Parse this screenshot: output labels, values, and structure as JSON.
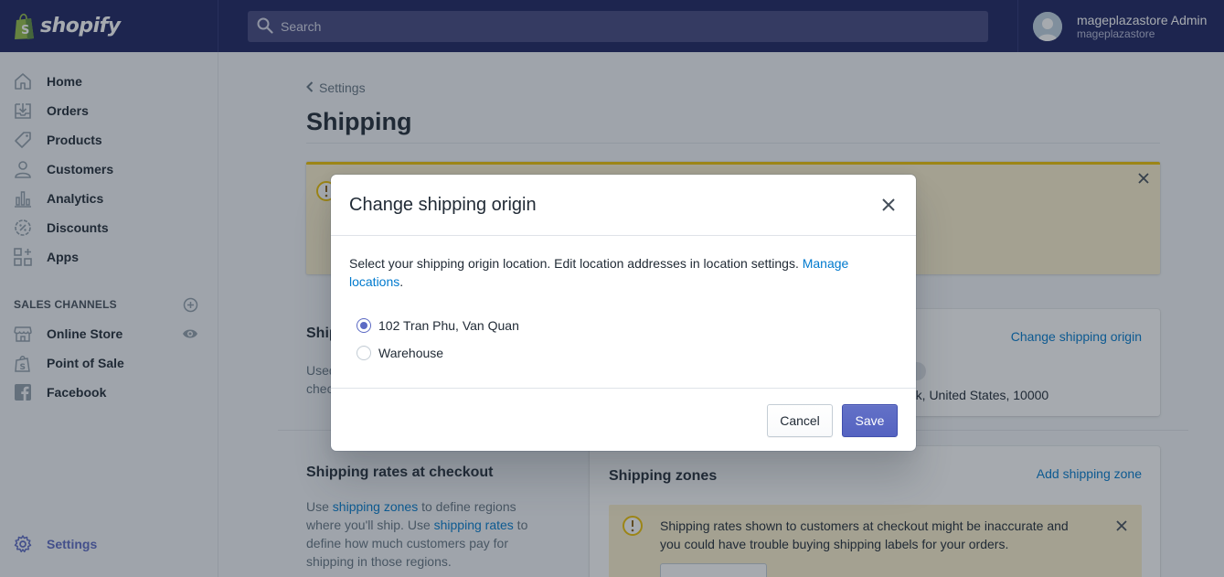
{
  "topbar": {
    "brand": "shopify",
    "search_placeholder": "Search",
    "user_name": "mageplazastore Admin",
    "user_store": "mageplazastore"
  },
  "sidebar": {
    "items": [
      {
        "label": "Home",
        "icon": "home-icon"
      },
      {
        "label": "Orders",
        "icon": "orders-icon"
      },
      {
        "label": "Products",
        "icon": "tag-icon"
      },
      {
        "label": "Customers",
        "icon": "person-icon"
      },
      {
        "label": "Analytics",
        "icon": "bar-chart-icon"
      },
      {
        "label": "Discounts",
        "icon": "discount-icon"
      },
      {
        "label": "Apps",
        "icon": "apps-icon"
      }
    ],
    "sales_channels_heading": "SALES CHANNELS",
    "channels": [
      {
        "label": "Online Store",
        "icon": "store-icon"
      },
      {
        "label": "Point of Sale",
        "icon": "pos-icon"
      },
      {
        "label": "Facebook",
        "icon": "facebook-icon"
      }
    ],
    "settings_label": "Settings"
  },
  "page": {
    "back_label": "Settings",
    "title": "Shipping",
    "origin_section_title": "Ship",
    "origin_section_desc_1": "Used",
    "origin_section_desc_2": "chec",
    "change_origin_link": "Change shipping origin",
    "origin_address": "rk, United States, 10000",
    "rates_title": "Shipping rates at checkout",
    "rates_desc_1": "Use ",
    "rates_link_zones": "shipping zones",
    "rates_desc_2": " to define regions",
    "rates_desc_3": "where you'll ship. Use ",
    "rates_link_rates": "shipping rates",
    "rates_desc_4": " to",
    "rates_desc_5": "define how much customers pay for",
    "rates_desc_6": "shipping in those regions.",
    "zones_title": "Shipping zones",
    "add_zone_link": "Add shipping zone",
    "zones_warning_1": "Shipping rates shown to customers at checkout might be inaccurate and",
    "zones_warning_2": "you could have trouble buying shipping labels for your orders."
  },
  "modal": {
    "title": "Change shipping origin",
    "body_text": "Select your shipping origin location. Edit location addresses in location settings. ",
    "manage_link_1": "Manage",
    "manage_link_2": "locations",
    "period": ".",
    "options": [
      {
        "label": "102 Tran Phu, Van Quan",
        "selected": true
      },
      {
        "label": "Warehouse",
        "selected": false
      }
    ],
    "cancel_label": "Cancel",
    "save_label": "Save"
  },
  "colors": {
    "topbar": "#1c2260",
    "accent": "#5c6ac4",
    "link": "#007ace",
    "warning_bg": "#fcf1cd"
  }
}
